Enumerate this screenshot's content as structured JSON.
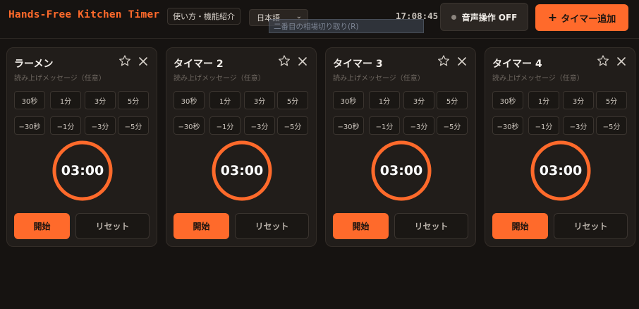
{
  "header": {
    "title": "Hands-Free Kitchen Timer",
    "help_label": "使い方・機能紹介",
    "language": "日本語",
    "tooltip": "二番目の相場切り取り(R)",
    "clock": "17:08:45",
    "voice_label": "音声操作 OFF",
    "add_label": "タイマー追加",
    "add_icon": "plus-icon"
  },
  "colors": {
    "accent": "#ff6a2b",
    "background": "#161311",
    "card": "#211d1a"
  },
  "message_placeholder": "読み上げメッセージ（任意）",
  "presets_plus": [
    "30秒",
    "1分",
    "3分",
    "5分"
  ],
  "presets_minus": [
    "−30秒",
    "−1分",
    "−3分",
    "−5分"
  ],
  "buttons": {
    "start": "開始",
    "reset": "リセット"
  },
  "timers": [
    {
      "name": "ラーメン",
      "time": "03:00",
      "progress": 1.0,
      "favorite": false
    },
    {
      "name": "タイマー 2",
      "time": "03:00",
      "progress": 1.0,
      "favorite": false
    },
    {
      "name": "タイマー 3",
      "time": "03:00",
      "progress": 1.0,
      "favorite": false
    },
    {
      "name": "タイマー 4",
      "time": "03:00",
      "progress": 1.0,
      "favorite": false
    }
  ]
}
